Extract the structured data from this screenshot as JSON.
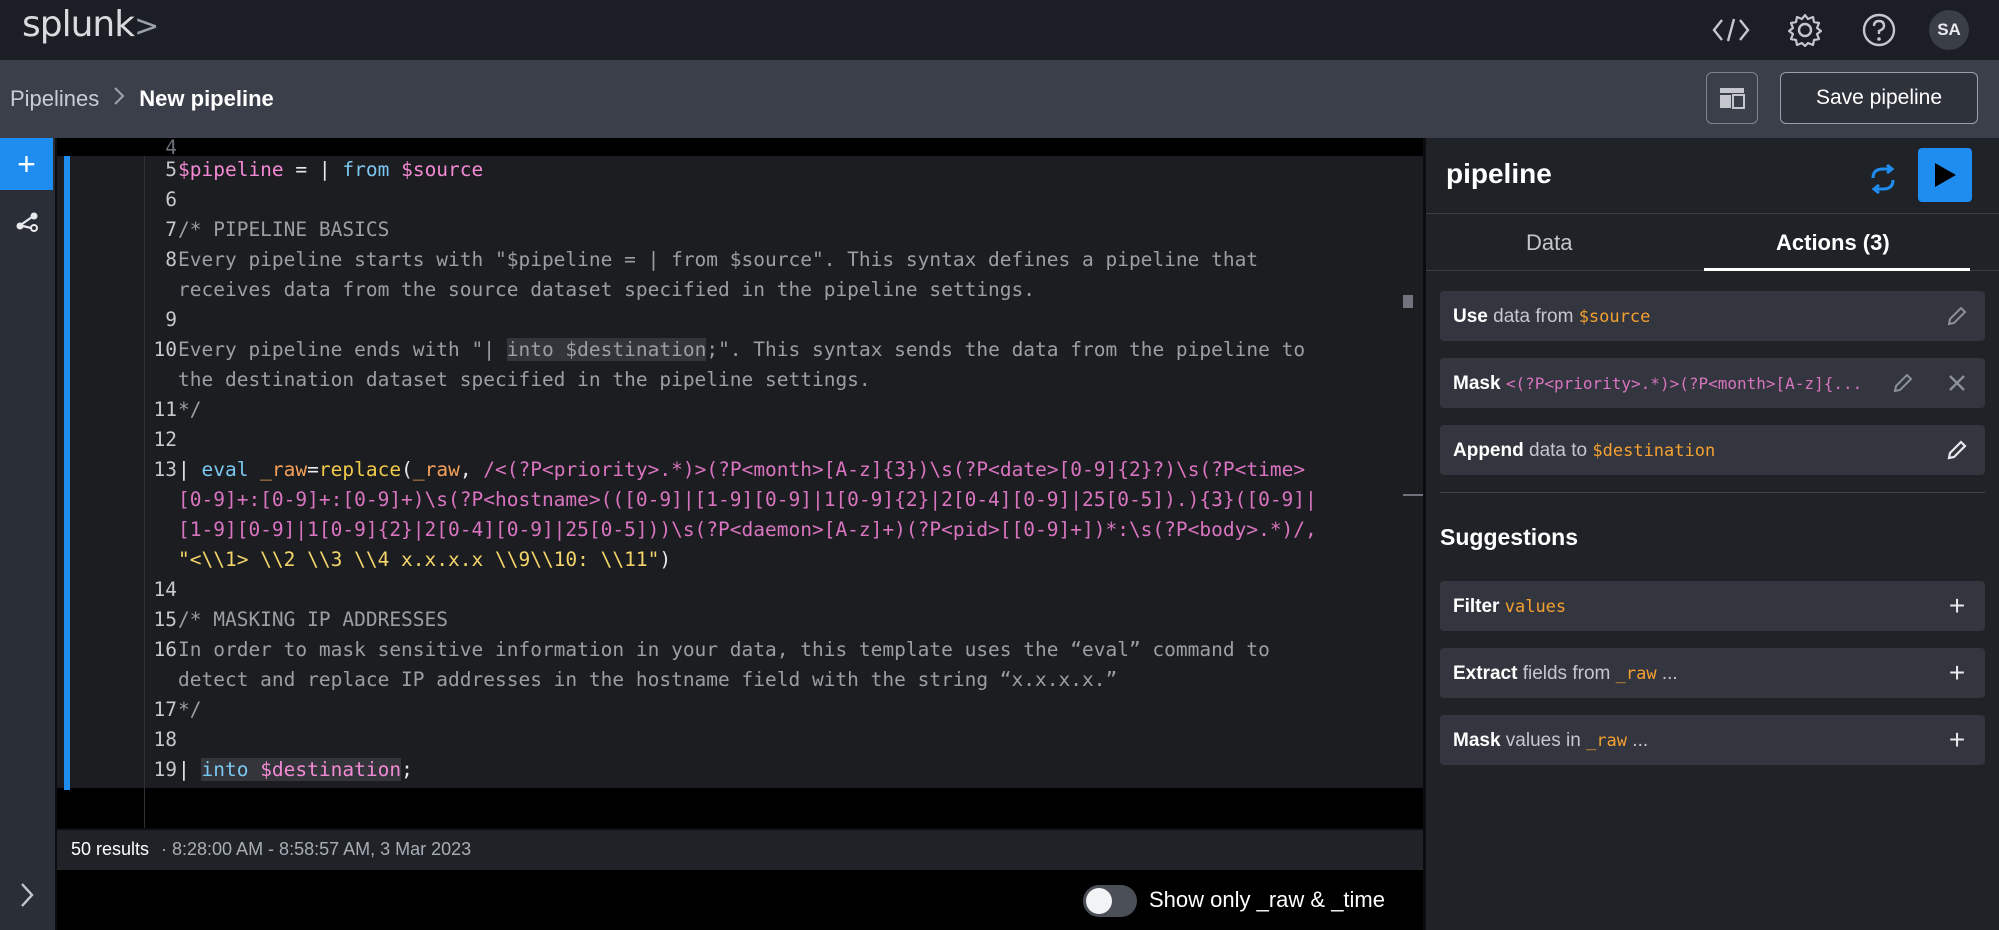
{
  "app": {
    "logo": "splunk",
    "logo_mark": ">",
    "avatar_initials": "SA",
    "icons": [
      "code-icon",
      "gear-icon",
      "help-icon"
    ]
  },
  "breadcrumb": {
    "parent": "Pipelines",
    "current": "New pipeline"
  },
  "toolbar": {
    "save_label": "Save pipeline",
    "layout_icon": "layout-icon"
  },
  "rail": {
    "add_label": "+",
    "expand_label": ">"
  },
  "editor": {
    "line_numbers": [
      "4",
      "5",
      "6",
      "7",
      "8",
      "",
      "9",
      "10",
      "",
      "11",
      "12",
      "13",
      "",
      "",
      "",
      "14",
      "15",
      "16",
      "",
      "17",
      "18",
      "19"
    ],
    "lines": {
      "l5_var": "$pipeline",
      "l5_eq": " = | ",
      "l5_from": "from",
      "l5_source": " $source",
      "l7": "/* PIPELINE BASICS",
      "l8a": "Every pipeline starts with \"$pipeline = | from $source\". This syntax defines a pipeline that",
      "l8b": "receives data from the source dataset specified in the pipeline settings.",
      "l10a_pre": "Every pipeline ends with \"| ",
      "l10a_hl": "into $destination",
      "l10a_post": ";\". This syntax sends the data from the pipeline to",
      "l10b": "the destination dataset specified in the pipeline settings.",
      "l11": "*/",
      "l13a_pipe": "| ",
      "l13a_eval": "eval",
      "l13a_raw": " _raw",
      "l13a_eq": "=",
      "l13a_fn": "replace",
      "l13a_p": "(",
      "l13a_arg": "_raw",
      "l13a_c": ", ",
      "l13a_re": "/<(?P<priority>.*)>(?P<month>[A-z]{3})\\s(?P<date>[0-9]{2}?)\\s(?P<time>",
      "l13b_re": "[0-9]+:[0-9]+:[0-9]+)\\s(?P<hostname>(([0-9]|[1-9][0-9]|1[0-9]{2}|2[0-4][0-9]|25[0-5]).){3}([0-9]|",
      "l13c_re": "[1-9][0-9]|1[0-9]{2}|2[0-4][0-9]|25[0-5]))\\s(?P<daemon>[A-z]+)(?P<pid>[[0-9]+])*:\\s(?P<body>.*)/,",
      "l13d_str": "\"<\\\\1> \\\\2 \\\\3 \\\\4 x.x.x.x \\\\9\\\\10: \\\\11\"",
      "l13d_close": ")",
      "l15": "/* MASKING IP ADDRESSES",
      "l16a": "In order to mask sensitive information in your data, this template uses the “eval” command to",
      "l16b": "detect and replace IP addresses in the hostname field with the string “x.x.x.x.”",
      "l17": "*/",
      "l19_pipe": "| ",
      "l19_into": "into",
      "l19_dest": " $destination",
      "l19_semi": ";"
    }
  },
  "status": {
    "count": "50 results",
    "range": "· 8:28:00 AM - 8:58:57 AM, 3 Mar 2023",
    "toggle_label": "Show only _raw & _time",
    "toggle_on": false
  },
  "panel": {
    "title": "pipeline",
    "tabs": [
      {
        "label": "Data",
        "active": false
      },
      {
        "label": "Actions (3)",
        "active": true
      }
    ],
    "actions": [
      {
        "verb": "Use",
        "text": " data from ",
        "token": "$source",
        "icon": "pencil-icon"
      },
      {
        "verb": "Mask",
        "text": " ",
        "token": "<(?P<priority>.*)>(?P<month>[A-z]{...",
        "icon": "pencil-icon",
        "icon2": "close-icon"
      },
      {
        "verb": "Append",
        "text": " data to ",
        "token": "$destination",
        "icon": "pencil-icon"
      }
    ],
    "suggestions_title": "Suggestions",
    "suggestions": [
      {
        "verb": "Filter",
        "text": " ",
        "token": "values",
        "tail": ""
      },
      {
        "verb": "Extract",
        "text": " fields from ",
        "token": "_raw",
        "tail": " ..."
      },
      {
        "verb": "Mask",
        "text": " values in ",
        "token": "_raw",
        "tail": " ..."
      }
    ]
  },
  "colors": {
    "accent": "#1f8cf0",
    "token_orange": "#f5a030",
    "regex_magenta": "#d974c0"
  }
}
